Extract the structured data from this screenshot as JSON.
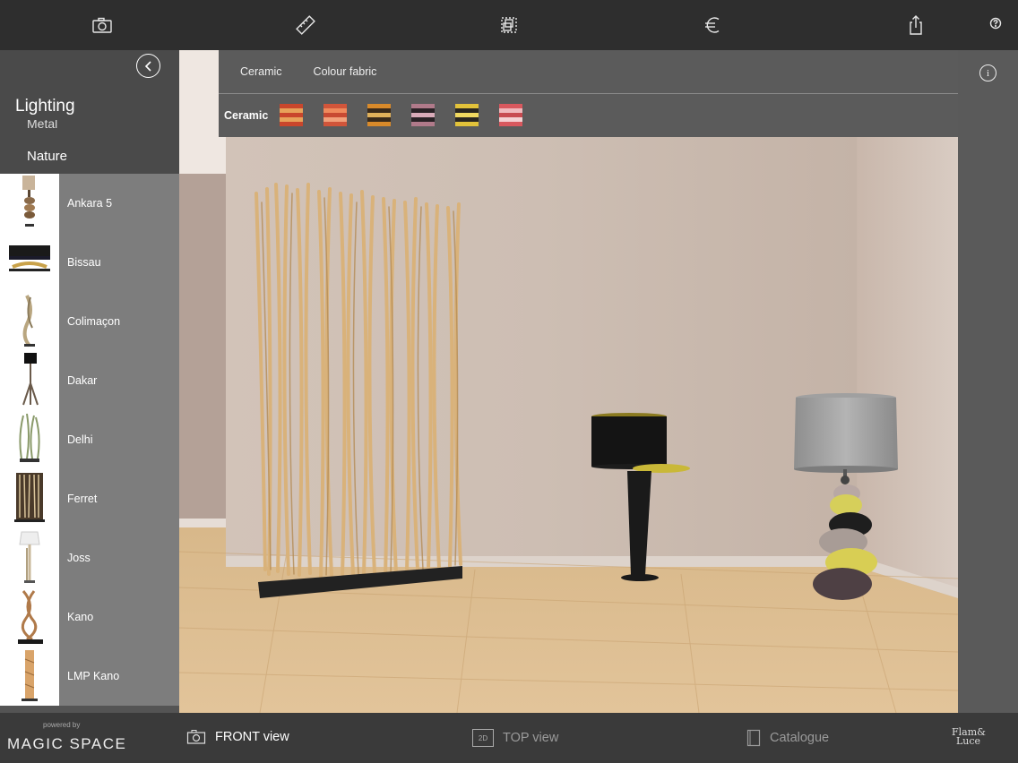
{
  "toolbar": {
    "icons": [
      "camera-icon",
      "ruler-icon",
      "layers-icon",
      "euro-icon",
      "share-icon",
      "help-icon"
    ]
  },
  "sidebar": {
    "title": "Lighting",
    "partial_category": "Metal",
    "category": "Nature",
    "items": [
      {
        "label": "Ankara 5"
      },
      {
        "label": "Bissau"
      },
      {
        "label": "Colimaçon"
      },
      {
        "label": "Dakar"
      },
      {
        "label": "Delhi"
      },
      {
        "label": "Ferret"
      },
      {
        "label": "Joss"
      },
      {
        "label": "Kano"
      },
      {
        "label": "LMP Kano"
      }
    ]
  },
  "materials": {
    "tabs": [
      "Ceramic",
      "Colour fabric"
    ],
    "active_label": "Ceramic",
    "swatches": [
      {
        "colors": [
          "#c9462c",
          "#e8a25a",
          "#c9462c",
          "#e8a25a",
          "#c9462c"
        ]
      },
      {
        "colors": [
          "#d1553a",
          "#f08a5c",
          "#c84a32",
          "#f2a07a",
          "#d1553a"
        ]
      },
      {
        "colors": [
          "#d98a2a",
          "#3a2a1a",
          "#e0b05a",
          "#3a2a1a",
          "#d98a2a"
        ]
      },
      {
        "colors": [
          "#b07a8a",
          "#2a2226",
          "#d8aab8",
          "#2a2226",
          "#b07a8a"
        ]
      },
      {
        "colors": [
          "#e2c23a",
          "#2a2620",
          "#f0d860",
          "#2a2620",
          "#e2c23a"
        ]
      },
      {
        "colors": [
          "#d8585e",
          "#f0b8bc",
          "#c84a50",
          "#f4d0d2",
          "#d8585e"
        ]
      }
    ]
  },
  "bottombar": {
    "powered_by": "powered by",
    "brand": "MAGIC SPACE",
    "front_view": "FRONT view",
    "top_view": "TOP view",
    "top_view_icon": "2D",
    "catalogue": "Catalogue",
    "logo_line1": "Flam&",
    "logo_line2": "Luce"
  },
  "colors": {
    "accent_white": "#ffffff",
    "dim_text": "#9a9a9a"
  }
}
